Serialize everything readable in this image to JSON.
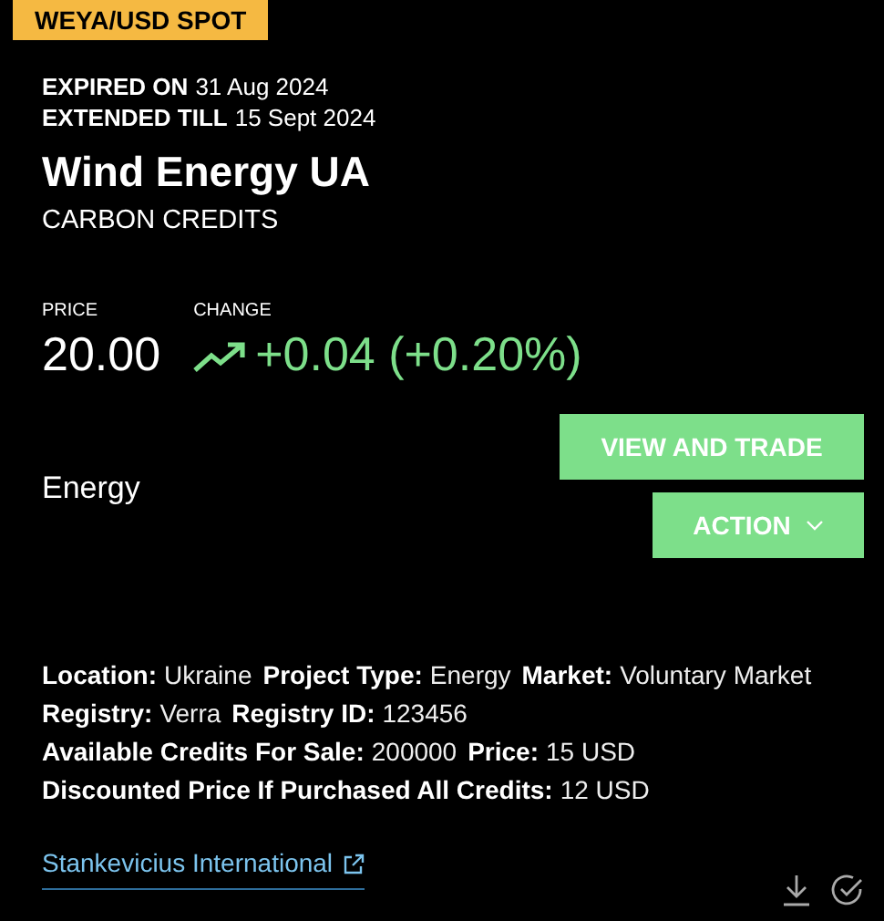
{
  "badge": "WEYA/USD SPOT",
  "dates": [
    {
      "label": "EXPIRED ON",
      "value": "31 Aug 2024"
    },
    {
      "label": "EXTENDED TILL",
      "value": "15 Sept 2024"
    }
  ],
  "title": "Wind Energy UA",
  "subtitle": "CARBON CREDITS",
  "price": {
    "label": "PRICE",
    "value": "20.00"
  },
  "change": {
    "label": "CHANGE",
    "value": "+0.04 (+0.20%)",
    "kind": "up"
  },
  "category": "Energy",
  "buttons": [
    {
      "label": "VIEW AND TRADE",
      "kind": "plain"
    },
    {
      "label": "ACTION",
      "kind": "dropdown"
    }
  ],
  "details": [
    [
      {
        "label": "Location:",
        "value": "Ukraine"
      },
      {
        "label": "Project Type:",
        "value": "Energy"
      },
      {
        "label": "Market:",
        "value": "Voluntary Market"
      }
    ],
    [
      {
        "label": "Registry:",
        "value": "Verra"
      },
      {
        "label": "Registry ID:",
        "value": "123456"
      }
    ],
    [
      {
        "label": "Available Credits For Sale:",
        "value": "200000"
      },
      {
        "label": "Price:",
        "value": "15 USD"
      }
    ],
    [
      {
        "label": "Discounted Price If Purchased All Credits:",
        "value": "12 USD"
      }
    ]
  ],
  "link": "Stankevicius International"
}
